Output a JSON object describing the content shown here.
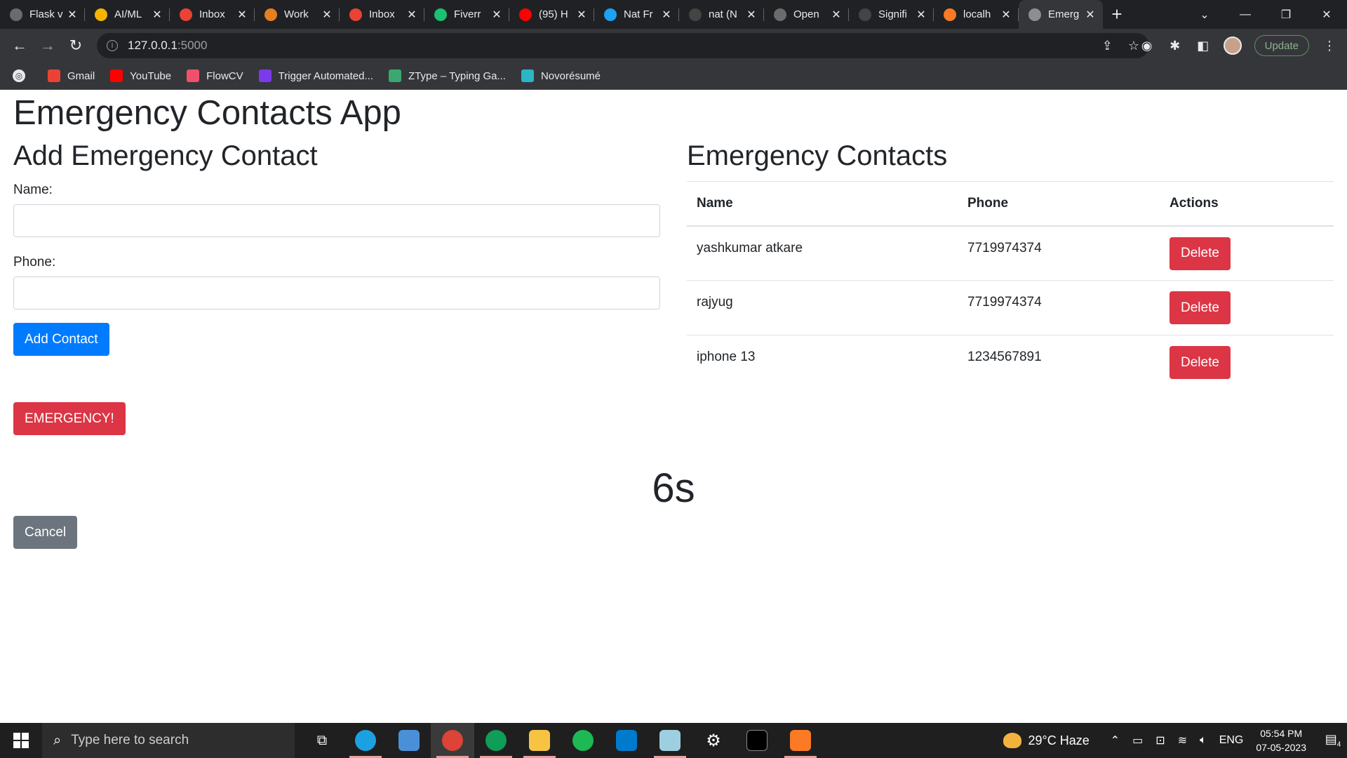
{
  "browser": {
    "tabs": [
      {
        "title": "Flask v",
        "icon": "openai-icon",
        "color": "#6b6b6b"
      },
      {
        "title": "AI/ML",
        "icon": "drive-icon",
        "color": "#f4b400"
      },
      {
        "title": "Inbox",
        "icon": "gmail-icon",
        "color": "#ea4335"
      },
      {
        "title": "Work",
        "icon": "work-icon",
        "color": "#e67e22"
      },
      {
        "title": "Inbox",
        "icon": "gmail-icon",
        "color": "#ea4335"
      },
      {
        "title": "Fiverr",
        "icon": "fiverr-icon",
        "color": "#1dbf73"
      },
      {
        "title": "(95) H",
        "icon": "youtube-icon",
        "color": "#ff0000"
      },
      {
        "title": "Nat Fr",
        "icon": "twitter-icon",
        "color": "#1da1f2"
      },
      {
        "title": "nat (N",
        "icon": "github-icon",
        "color": "#444444"
      },
      {
        "title": "Open",
        "icon": "openai-icon",
        "color": "#6b6b6b"
      },
      {
        "title": "Signifi",
        "icon": "github-icon",
        "color": "#444444"
      },
      {
        "title": "localh",
        "icon": "xampp-icon",
        "color": "#fb7a24"
      },
      {
        "title": "Emerg",
        "icon": "globe-icon",
        "color": "#8e8e8e",
        "active": true
      }
    ],
    "url_host": "127.0.0.1",
    "url_port": ":5000",
    "update_label": "Update",
    "bookmarks": [
      {
        "label": "Gmail",
        "icon": "gmail-icon",
        "color": "#ea4335"
      },
      {
        "label": "YouTube",
        "icon": "youtube-icon",
        "color": "#ff0000"
      },
      {
        "label": "FlowCV",
        "icon": "flowcv-icon",
        "color": "#f0506e"
      },
      {
        "label": "Trigger Automated...",
        "icon": "trigger-icon",
        "color": "#7c3aed"
      },
      {
        "label": "ZType – Typing Ga...",
        "icon": "ztype-icon",
        "color": "#3aa870"
      },
      {
        "label": "Novorésumé",
        "icon": "novoresume-icon",
        "color": "#2bb5c8"
      }
    ]
  },
  "app": {
    "title": "Emergency Contacts App",
    "form": {
      "heading": "Add Emergency Contact",
      "name_label": "Name:",
      "name_value": "",
      "phone_label": "Phone:",
      "phone_value": "",
      "submit_label": "Add Contact"
    },
    "emergency_label": "EMERGENCY!",
    "countdown": "6s",
    "cancel_label": "Cancel",
    "contacts": {
      "heading": "Emergency Contacts",
      "columns": [
        "Name",
        "Phone",
        "Actions"
      ],
      "rows": [
        {
          "name": "yashkumar atkare",
          "phone": "7719974374",
          "action": "Delete"
        },
        {
          "name": "rajyug",
          "phone": "7719974374",
          "action": "Delete"
        },
        {
          "name": "iphone 13",
          "phone": "1234567891",
          "action": "Delete"
        }
      ]
    }
  },
  "taskbar": {
    "search_placeholder": "Type here to search",
    "weather": "29°C  Haze",
    "language": "ENG",
    "time": "05:54 PM",
    "date": "07-05-2023",
    "notifications": "4"
  }
}
